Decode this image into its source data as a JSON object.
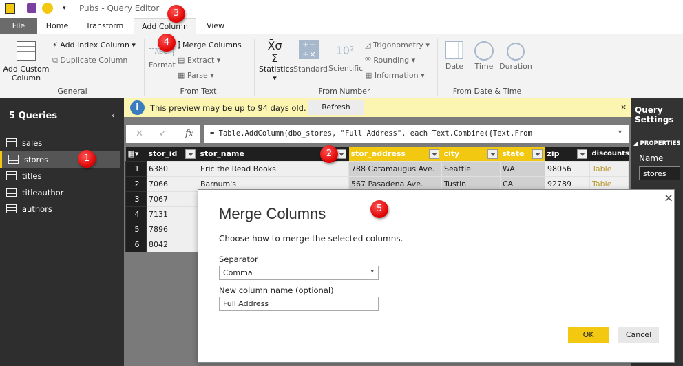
{
  "window": {
    "title": "Pubs - Query Editor"
  },
  "tabs": [
    {
      "label": "File"
    },
    {
      "label": "Home"
    },
    {
      "label": "Transform"
    },
    {
      "label": "Add Column"
    },
    {
      "label": "View"
    }
  ],
  "ribbon": {
    "general": {
      "label": "General",
      "add_custom": "Add Custom Column",
      "add_index": "Add Index Column",
      "duplicate": "Duplicate Column"
    },
    "from_text": {
      "label": "From Text",
      "format": "Format",
      "merge": "Merge Columns",
      "extract": "Extract",
      "parse": "Parse"
    },
    "from_number": {
      "label": "From Number",
      "statistics": "Statistics",
      "standard": "Standard",
      "scientific": "Scientific",
      "trigonometry": "Trigonometry",
      "rounding": "Rounding",
      "information": "Information"
    },
    "from_datetime": {
      "label": "From Date & Time",
      "date": "Date",
      "time": "Time",
      "duration": "Duration"
    }
  },
  "queries": {
    "title": "5 Queries",
    "items": [
      "sales",
      "stores",
      "titles",
      "titleauthor",
      "authors"
    ],
    "selected": "stores"
  },
  "notice": {
    "text": "This preview may be up to 94 days old.",
    "refresh": "Refresh"
  },
  "formula": {
    "value": "= Table.AddColumn(dbo_stores, \"Full Address\", each Text.Combine({Text.From"
  },
  "table": {
    "columns": [
      "stor_id",
      "stor_name",
      "stor_address",
      "city",
      "state",
      "zip",
      "discounts"
    ],
    "selected_columns": [
      "stor_address",
      "city",
      "state"
    ],
    "rows": [
      [
        "1",
        "6380",
        "Eric the Read Books",
        "788 Catamaugus Ave.",
        "Seattle",
        "WA",
        "98056",
        "Table"
      ],
      [
        "2",
        "7066",
        "Barnum's",
        "567 Pasadena Ave.",
        "Tustin",
        "CA",
        "92789",
        "Table"
      ],
      [
        "3",
        "7067"
      ],
      [
        "4",
        "7131"
      ],
      [
        "5",
        "7896"
      ],
      [
        "6",
        "8042"
      ]
    ]
  },
  "query_settings": {
    "title": "Query Settings",
    "properties": "PROPERTIES",
    "name_label": "Name",
    "name_value": "stores"
  },
  "dialog": {
    "title": "Merge Columns",
    "subtitle": "Choose how to merge the selected columns.",
    "separator_label": "Separator",
    "separator_value": "Comma",
    "name_label": "New column name (optional)",
    "name_value": "Full Address",
    "ok": "OK",
    "cancel": "Cancel"
  },
  "badges": [
    "1",
    "2",
    "3",
    "4",
    "5"
  ],
  "colors": {
    "accent": "#f2c811",
    "notice": "#fbf5b1",
    "badge": "#e01010"
  }
}
